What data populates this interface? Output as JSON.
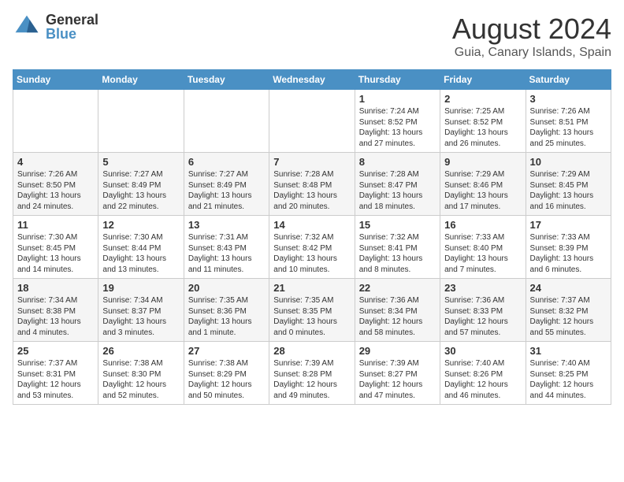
{
  "logo": {
    "general": "General",
    "blue": "Blue"
  },
  "header": {
    "month_year": "August 2024",
    "location": "Guia, Canary Islands, Spain"
  },
  "days_of_week": [
    "Sunday",
    "Monday",
    "Tuesday",
    "Wednesday",
    "Thursday",
    "Friday",
    "Saturday"
  ],
  "weeks": [
    [
      {
        "day": "",
        "info": ""
      },
      {
        "day": "",
        "info": ""
      },
      {
        "day": "",
        "info": ""
      },
      {
        "day": "",
        "info": ""
      },
      {
        "day": "1",
        "info": "Sunrise: 7:24 AM\nSunset: 8:52 PM\nDaylight: 13 hours\nand 27 minutes."
      },
      {
        "day": "2",
        "info": "Sunrise: 7:25 AM\nSunset: 8:52 PM\nDaylight: 13 hours\nand 26 minutes."
      },
      {
        "day": "3",
        "info": "Sunrise: 7:26 AM\nSunset: 8:51 PM\nDaylight: 13 hours\nand 25 minutes."
      }
    ],
    [
      {
        "day": "4",
        "info": "Sunrise: 7:26 AM\nSunset: 8:50 PM\nDaylight: 13 hours\nand 24 minutes."
      },
      {
        "day": "5",
        "info": "Sunrise: 7:27 AM\nSunset: 8:49 PM\nDaylight: 13 hours\nand 22 minutes."
      },
      {
        "day": "6",
        "info": "Sunrise: 7:27 AM\nSunset: 8:49 PM\nDaylight: 13 hours\nand 21 minutes."
      },
      {
        "day": "7",
        "info": "Sunrise: 7:28 AM\nSunset: 8:48 PM\nDaylight: 13 hours\nand 20 minutes."
      },
      {
        "day": "8",
        "info": "Sunrise: 7:28 AM\nSunset: 8:47 PM\nDaylight: 13 hours\nand 18 minutes."
      },
      {
        "day": "9",
        "info": "Sunrise: 7:29 AM\nSunset: 8:46 PM\nDaylight: 13 hours\nand 17 minutes."
      },
      {
        "day": "10",
        "info": "Sunrise: 7:29 AM\nSunset: 8:45 PM\nDaylight: 13 hours\nand 16 minutes."
      }
    ],
    [
      {
        "day": "11",
        "info": "Sunrise: 7:30 AM\nSunset: 8:45 PM\nDaylight: 13 hours\nand 14 minutes."
      },
      {
        "day": "12",
        "info": "Sunrise: 7:30 AM\nSunset: 8:44 PM\nDaylight: 13 hours\nand 13 minutes."
      },
      {
        "day": "13",
        "info": "Sunrise: 7:31 AM\nSunset: 8:43 PM\nDaylight: 13 hours\nand 11 minutes."
      },
      {
        "day": "14",
        "info": "Sunrise: 7:32 AM\nSunset: 8:42 PM\nDaylight: 13 hours\nand 10 minutes."
      },
      {
        "day": "15",
        "info": "Sunrise: 7:32 AM\nSunset: 8:41 PM\nDaylight: 13 hours\nand 8 minutes."
      },
      {
        "day": "16",
        "info": "Sunrise: 7:33 AM\nSunset: 8:40 PM\nDaylight: 13 hours\nand 7 minutes."
      },
      {
        "day": "17",
        "info": "Sunrise: 7:33 AM\nSunset: 8:39 PM\nDaylight: 13 hours\nand 6 minutes."
      }
    ],
    [
      {
        "day": "18",
        "info": "Sunrise: 7:34 AM\nSunset: 8:38 PM\nDaylight: 13 hours\nand 4 minutes."
      },
      {
        "day": "19",
        "info": "Sunrise: 7:34 AM\nSunset: 8:37 PM\nDaylight: 13 hours\nand 3 minutes."
      },
      {
        "day": "20",
        "info": "Sunrise: 7:35 AM\nSunset: 8:36 PM\nDaylight: 13 hours\nand 1 minute."
      },
      {
        "day": "21",
        "info": "Sunrise: 7:35 AM\nSunset: 8:35 PM\nDaylight: 13 hours\nand 0 minutes."
      },
      {
        "day": "22",
        "info": "Sunrise: 7:36 AM\nSunset: 8:34 PM\nDaylight: 12 hours\nand 58 minutes."
      },
      {
        "day": "23",
        "info": "Sunrise: 7:36 AM\nSunset: 8:33 PM\nDaylight: 12 hours\nand 57 minutes."
      },
      {
        "day": "24",
        "info": "Sunrise: 7:37 AM\nSunset: 8:32 PM\nDaylight: 12 hours\nand 55 minutes."
      }
    ],
    [
      {
        "day": "25",
        "info": "Sunrise: 7:37 AM\nSunset: 8:31 PM\nDaylight: 12 hours\nand 53 minutes."
      },
      {
        "day": "26",
        "info": "Sunrise: 7:38 AM\nSunset: 8:30 PM\nDaylight: 12 hours\nand 52 minutes."
      },
      {
        "day": "27",
        "info": "Sunrise: 7:38 AM\nSunset: 8:29 PM\nDaylight: 12 hours\nand 50 minutes."
      },
      {
        "day": "28",
        "info": "Sunrise: 7:39 AM\nSunset: 8:28 PM\nDaylight: 12 hours\nand 49 minutes."
      },
      {
        "day": "29",
        "info": "Sunrise: 7:39 AM\nSunset: 8:27 PM\nDaylight: 12 hours\nand 47 minutes."
      },
      {
        "day": "30",
        "info": "Sunrise: 7:40 AM\nSunset: 8:26 PM\nDaylight: 12 hours\nand 46 minutes."
      },
      {
        "day": "31",
        "info": "Sunrise: 7:40 AM\nSunset: 8:25 PM\nDaylight: 12 hours\nand 44 minutes."
      }
    ]
  ]
}
